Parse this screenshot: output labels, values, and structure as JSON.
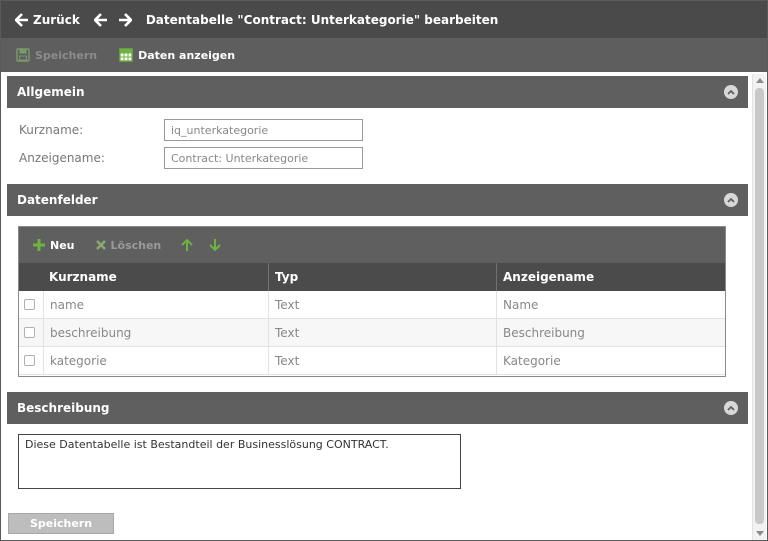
{
  "header": {
    "back_label": "Zurück",
    "title": "Datentabelle \"Contract: Unterkategorie\" bearbeiten"
  },
  "toolbar": {
    "save_label": "Speichern",
    "show_data_label": "Daten anzeigen"
  },
  "sections": {
    "general": {
      "title": "Allgemein"
    },
    "fields": {
      "title": "Datenfelder"
    },
    "description": {
      "title": "Beschreibung"
    }
  },
  "general": {
    "shortname_label": "Kurzname:",
    "shortname_value": "iq_unterkategorie",
    "displayname_label": "Anzeigename:",
    "displayname_value": "Contract: Unterkategorie"
  },
  "grid": {
    "toolbar": {
      "new_label": "Neu",
      "delete_label": "Löschen"
    },
    "columns": [
      "Kurzname",
      "Typ",
      "Anzeigename"
    ],
    "rows": [
      [
        "name",
        "Text",
        "Name"
      ],
      [
        "beschreibung",
        "Text",
        "Beschreibung"
      ],
      [
        "kategorie",
        "Text",
        "Kategorie"
      ]
    ]
  },
  "description": {
    "text": "Diese Datentabelle ist Bestandteil der Businesslösung CONTRACT."
  },
  "footer": {
    "save_label": "Speichern"
  },
  "colors": {
    "topbar": "#4a4a4a",
    "section_header": "#5f5f5f",
    "accent_green": "#6cb33f"
  }
}
